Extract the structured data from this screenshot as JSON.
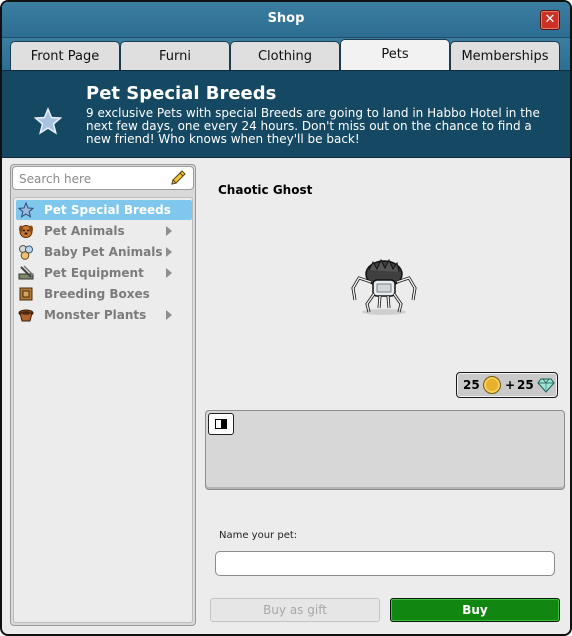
{
  "window": {
    "title": "Shop",
    "close_label": "✕"
  },
  "tabs": [
    {
      "label": "Front Page"
    },
    {
      "label": "Furni"
    },
    {
      "label": "Clothing"
    },
    {
      "label": "Pets",
      "active": true
    },
    {
      "label": "Memberships"
    }
  ],
  "banner": {
    "title": "Pet Special Breeds",
    "description": "9 exclusive Pets with special Breeds are going to land in Habbo Hotel in the next few days, one every 24 hours. Don't miss out on the chance to find a new friend! Who knows when they'll be back!",
    "icon": "star-icon"
  },
  "sidebar": {
    "search_placeholder": "Search here",
    "items": [
      {
        "label": "Pet Special Breeds",
        "icon": "star-icon",
        "selected": true,
        "has_children": false
      },
      {
        "label": "Pet Animals",
        "icon": "dog-icon",
        "selected": false,
        "has_children": true
      },
      {
        "label": "Baby Pet Animals",
        "icon": "baby-pets-icon",
        "selected": false,
        "has_children": true
      },
      {
        "label": "Pet Equipment",
        "icon": "equipment-icon",
        "selected": false,
        "has_children": true
      },
      {
        "label": "Breeding Boxes",
        "icon": "box-icon",
        "selected": false,
        "has_children": false
      },
      {
        "label": "Monster Plants",
        "icon": "plant-pot-icon",
        "selected": false,
        "has_children": true
      }
    ]
  },
  "product": {
    "name": "Chaotic Ghost",
    "price_credits": "25",
    "price_plus": "+",
    "price_diamonds": "25"
  },
  "form": {
    "name_label": "Name your pet:",
    "name_value": ""
  },
  "buttons": {
    "gift_label": "Buy as gift",
    "buy_label": "Buy"
  },
  "colors": {
    "header_blue": "#2d6d92",
    "banner_bg": "#154863",
    "selected_item": "#7fc7ec",
    "buy_green": "#118712",
    "close_red": "#c93225"
  }
}
